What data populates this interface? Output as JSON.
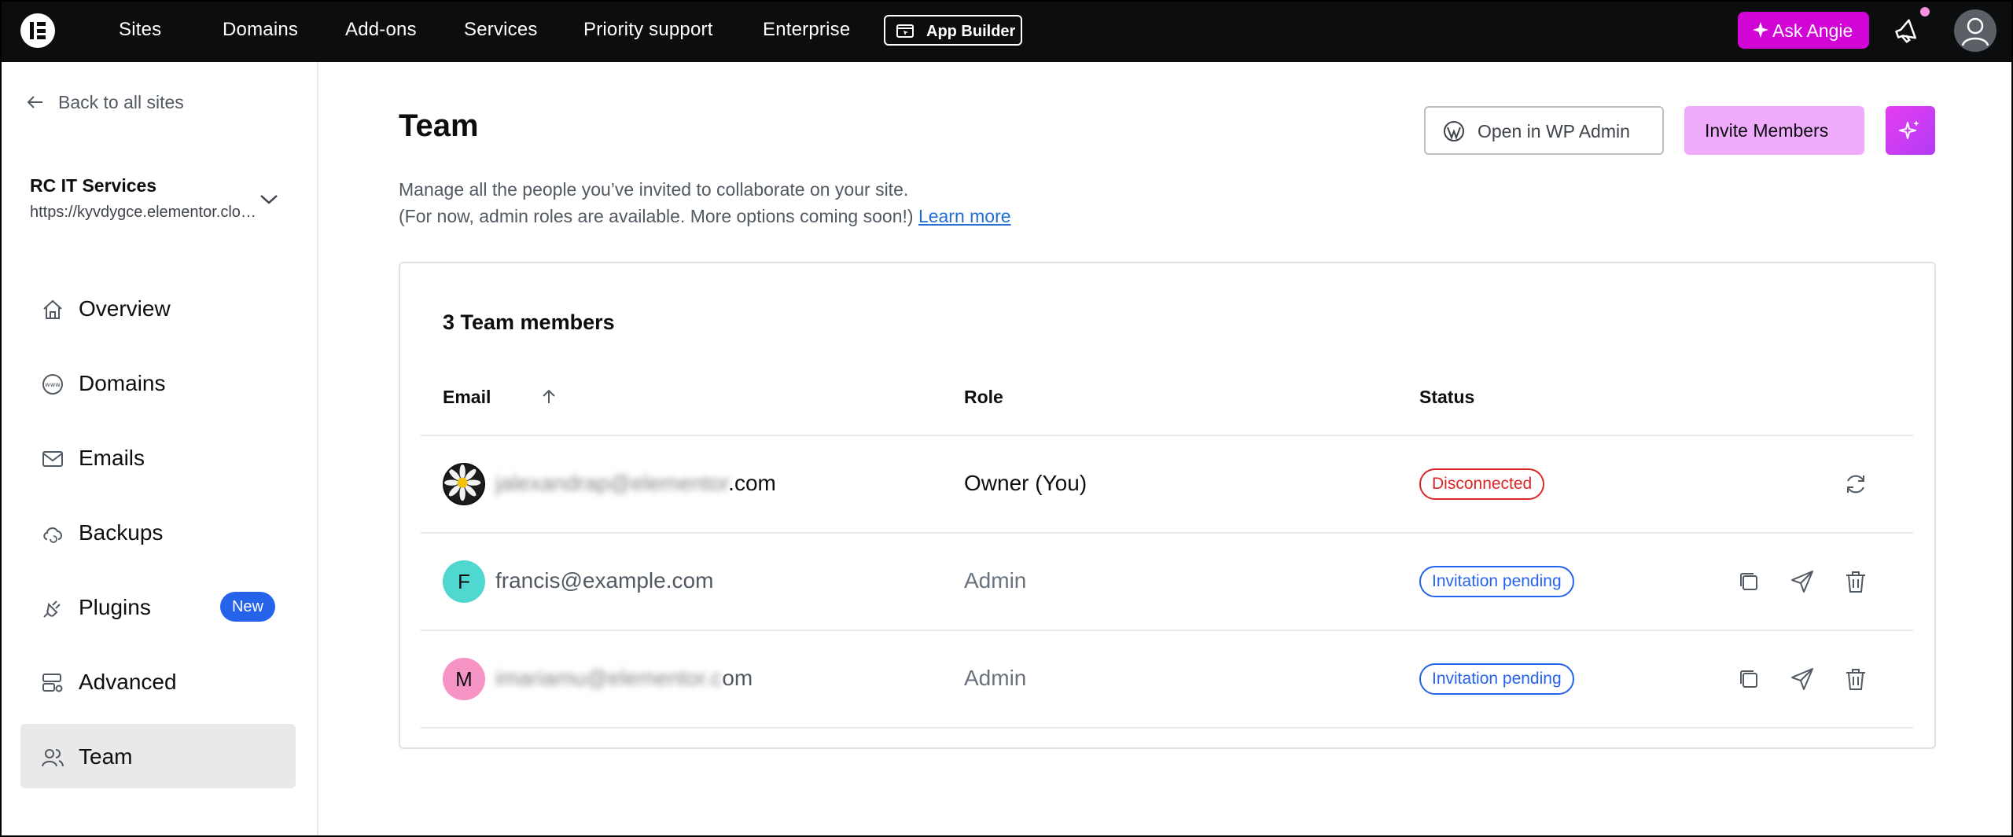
{
  "topnav": {
    "items": [
      "Sites",
      "Domains",
      "Add-ons",
      "Services",
      "Priority support",
      "Enterprise"
    ],
    "app_builder_label": "App Builder",
    "ask_angie_label": "Ask Angie"
  },
  "sidebar": {
    "back_label": "Back to all sites",
    "site_name": "RC IT Services",
    "site_url": "https://kyvdygce.elementor.cloud",
    "items": [
      {
        "label": "Overview",
        "icon": "home-icon"
      },
      {
        "label": "Domains",
        "icon": "www-icon"
      },
      {
        "label": "Emails",
        "icon": "mail-icon"
      },
      {
        "label": "Backups",
        "icon": "cloud-backup-icon"
      },
      {
        "label": "Plugins",
        "icon": "plug-icon",
        "badge": "New"
      },
      {
        "label": "Advanced",
        "icon": "server-settings-icon"
      },
      {
        "label": "Team",
        "icon": "users-icon",
        "active": true
      }
    ]
  },
  "main": {
    "title": "Team",
    "description_line1": "Manage all the people you’ve invited to collaborate on your site.",
    "description_line2": "(For now, admin roles are available. More options coming soon!)",
    "learn_more": "Learn more",
    "open_wp_admin_label": "Open in WP Admin",
    "invite_members_label": "Invite Members"
  },
  "team_table": {
    "title": "3 Team members",
    "columns": {
      "email": "Email",
      "role": "Role",
      "status": "Status"
    },
    "rows": [
      {
        "email_hidden": "jalexandrap@elementor",
        "email_visible": ".com",
        "initial": "",
        "role": "Owner (You)",
        "status": "Disconnected"
      },
      {
        "email_hidden": "",
        "email_visible": "francis@example.com",
        "initial": "F",
        "role": "Admin",
        "status": "Invitation pending"
      },
      {
        "email_hidden": "imariamu@elementor.c",
        "email_visible": "om",
        "initial": "M",
        "role": "Admin",
        "status": "Invitation pending"
      }
    ]
  },
  "colors": {
    "accent_pink": "#d004d4",
    "invite_bg": "#f0abfc",
    "status_red": "#dc2626",
    "status_blue": "#2563eb",
    "new_badge": "#2563eb"
  }
}
